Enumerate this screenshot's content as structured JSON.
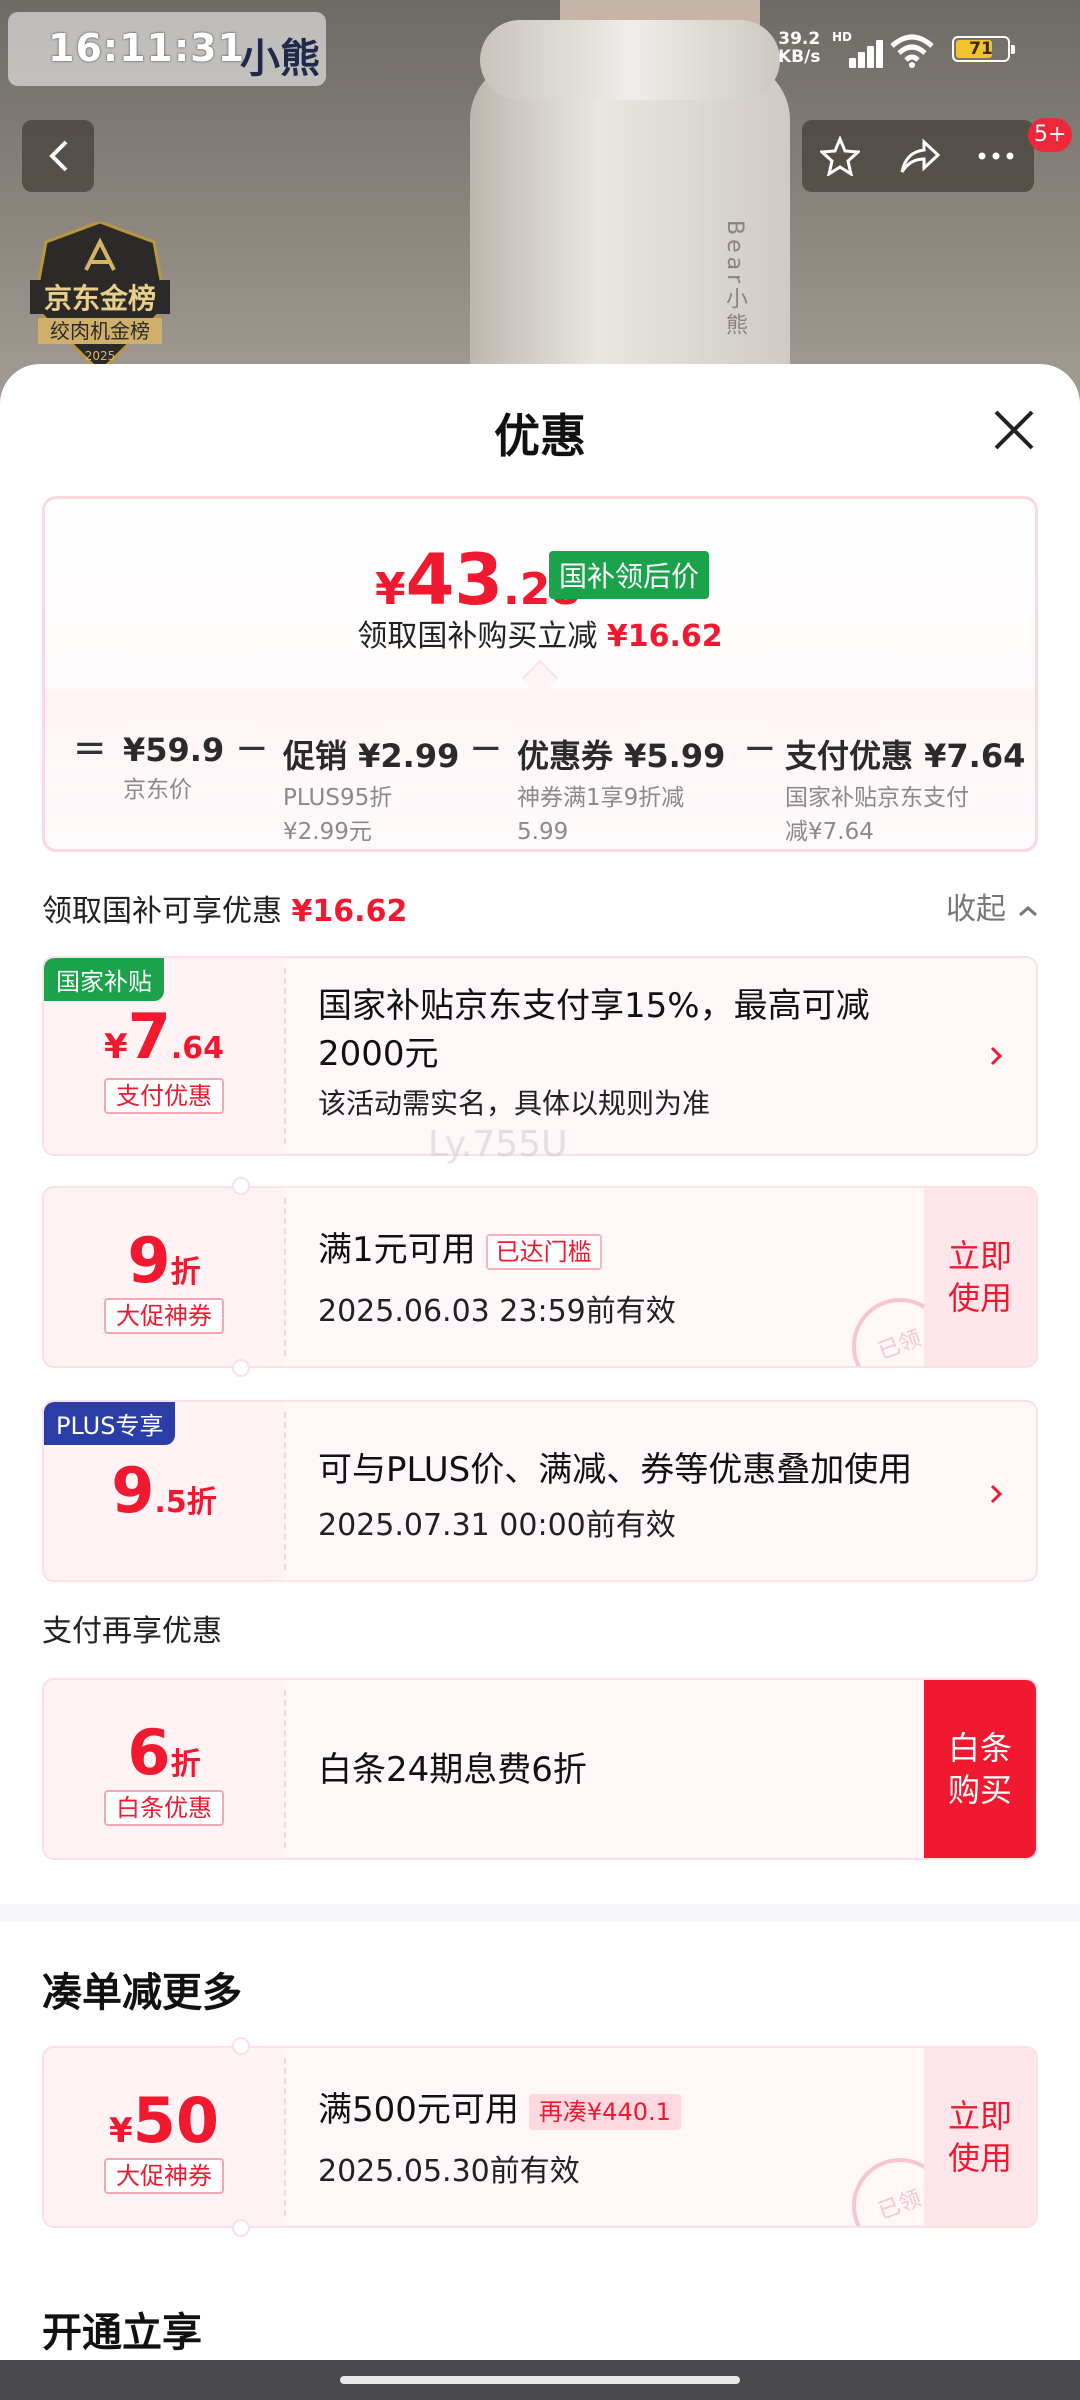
{
  "status_bar": {
    "time": "16:11:31",
    "net_speed": "39.2\nKB/s",
    "hd": "HD",
    "battery": "71",
    "battery_fill": 0.71
  },
  "background": {
    "brand": "小熊",
    "badge_title": "京东金榜",
    "badge_sub": "绞肉机金榜",
    "badge_year": "2025",
    "product_mark": "Bear小熊"
  },
  "nav": {
    "badge_count": "5+"
  },
  "sheet": {
    "title": "优惠",
    "price": {
      "currency": "¥",
      "integer": "43",
      "decimal": ".28",
      "tag": "国补领后价",
      "subtitle": "领取国补购买立减",
      "subtitle_amount": "¥16.62"
    },
    "formula": [
      {
        "op": "=",
        "title": "¥59.9",
        "desc": "京东价"
      },
      {
        "op": "−",
        "title": "促销 ¥2.99",
        "desc": "PLUS95折\n¥2.99元"
      },
      {
        "op": "−",
        "title": "优惠券 ¥5.99",
        "desc": "神券满1享9折减\n5.99"
      },
      {
        "op": "−",
        "title": "支付优惠 ¥7.64",
        "desc": "国家补贴京东支付\n减¥7.64"
      }
    ],
    "savings_header": {
      "label": "领取国补可享优惠",
      "amount": "¥16.62",
      "collapse": "收起"
    },
    "cards": [
      {
        "ribbon": "国家补贴",
        "ribbon_color": "#1aa34a",
        "cur": "¥",
        "num": "7",
        "dec": ".64",
        "unit": "",
        "chip": "支付优惠",
        "main": "国家补贴京东支付享15%，最高可减\n2000元",
        "sub": "该活动需实名，具体以规则为准",
        "has_arrow": true
      },
      {
        "cur": "",
        "num": "9",
        "dec": "",
        "unit": "折",
        "chip": "大促神券",
        "main": "满1元可用",
        "tag": "已达门槛",
        "sub": "2025.06.03 23:59前有效",
        "cta": "立即\n使用",
        "stamp": "已领"
      },
      {
        "ribbon": "PLUS专享",
        "ribbon_color": "#2b3ea8",
        "cur": "",
        "num": "9",
        "dec": ".5",
        "unit": "折",
        "main": "可与PLUS价、满减、券等优惠叠加使用",
        "sub": "2025.07.31 00:00前有效",
        "has_arrow": true
      }
    ],
    "pay_section": "支付再享优惠",
    "pay_card": {
      "num": "6",
      "unit": "折",
      "chip": "白条优惠",
      "main": "白条24期息费6折",
      "cta": "白条\n购买"
    },
    "more_section": "凑单减更多",
    "more_card": {
      "cur": "¥",
      "num": "50",
      "chip": "大促神券",
      "main": "满500元可用",
      "tag": "再凑¥440.1",
      "sub": "2025.05.30前有效",
      "cta": "立即\n使用",
      "stamp": "已领"
    },
    "open_section": "开通立享",
    "watermark": "Ly.755U"
  },
  "colors": {
    "accent": "#f0192f",
    "subsidy_green": "#1aa34a",
    "plus_blue": "#2b3ea8"
  }
}
